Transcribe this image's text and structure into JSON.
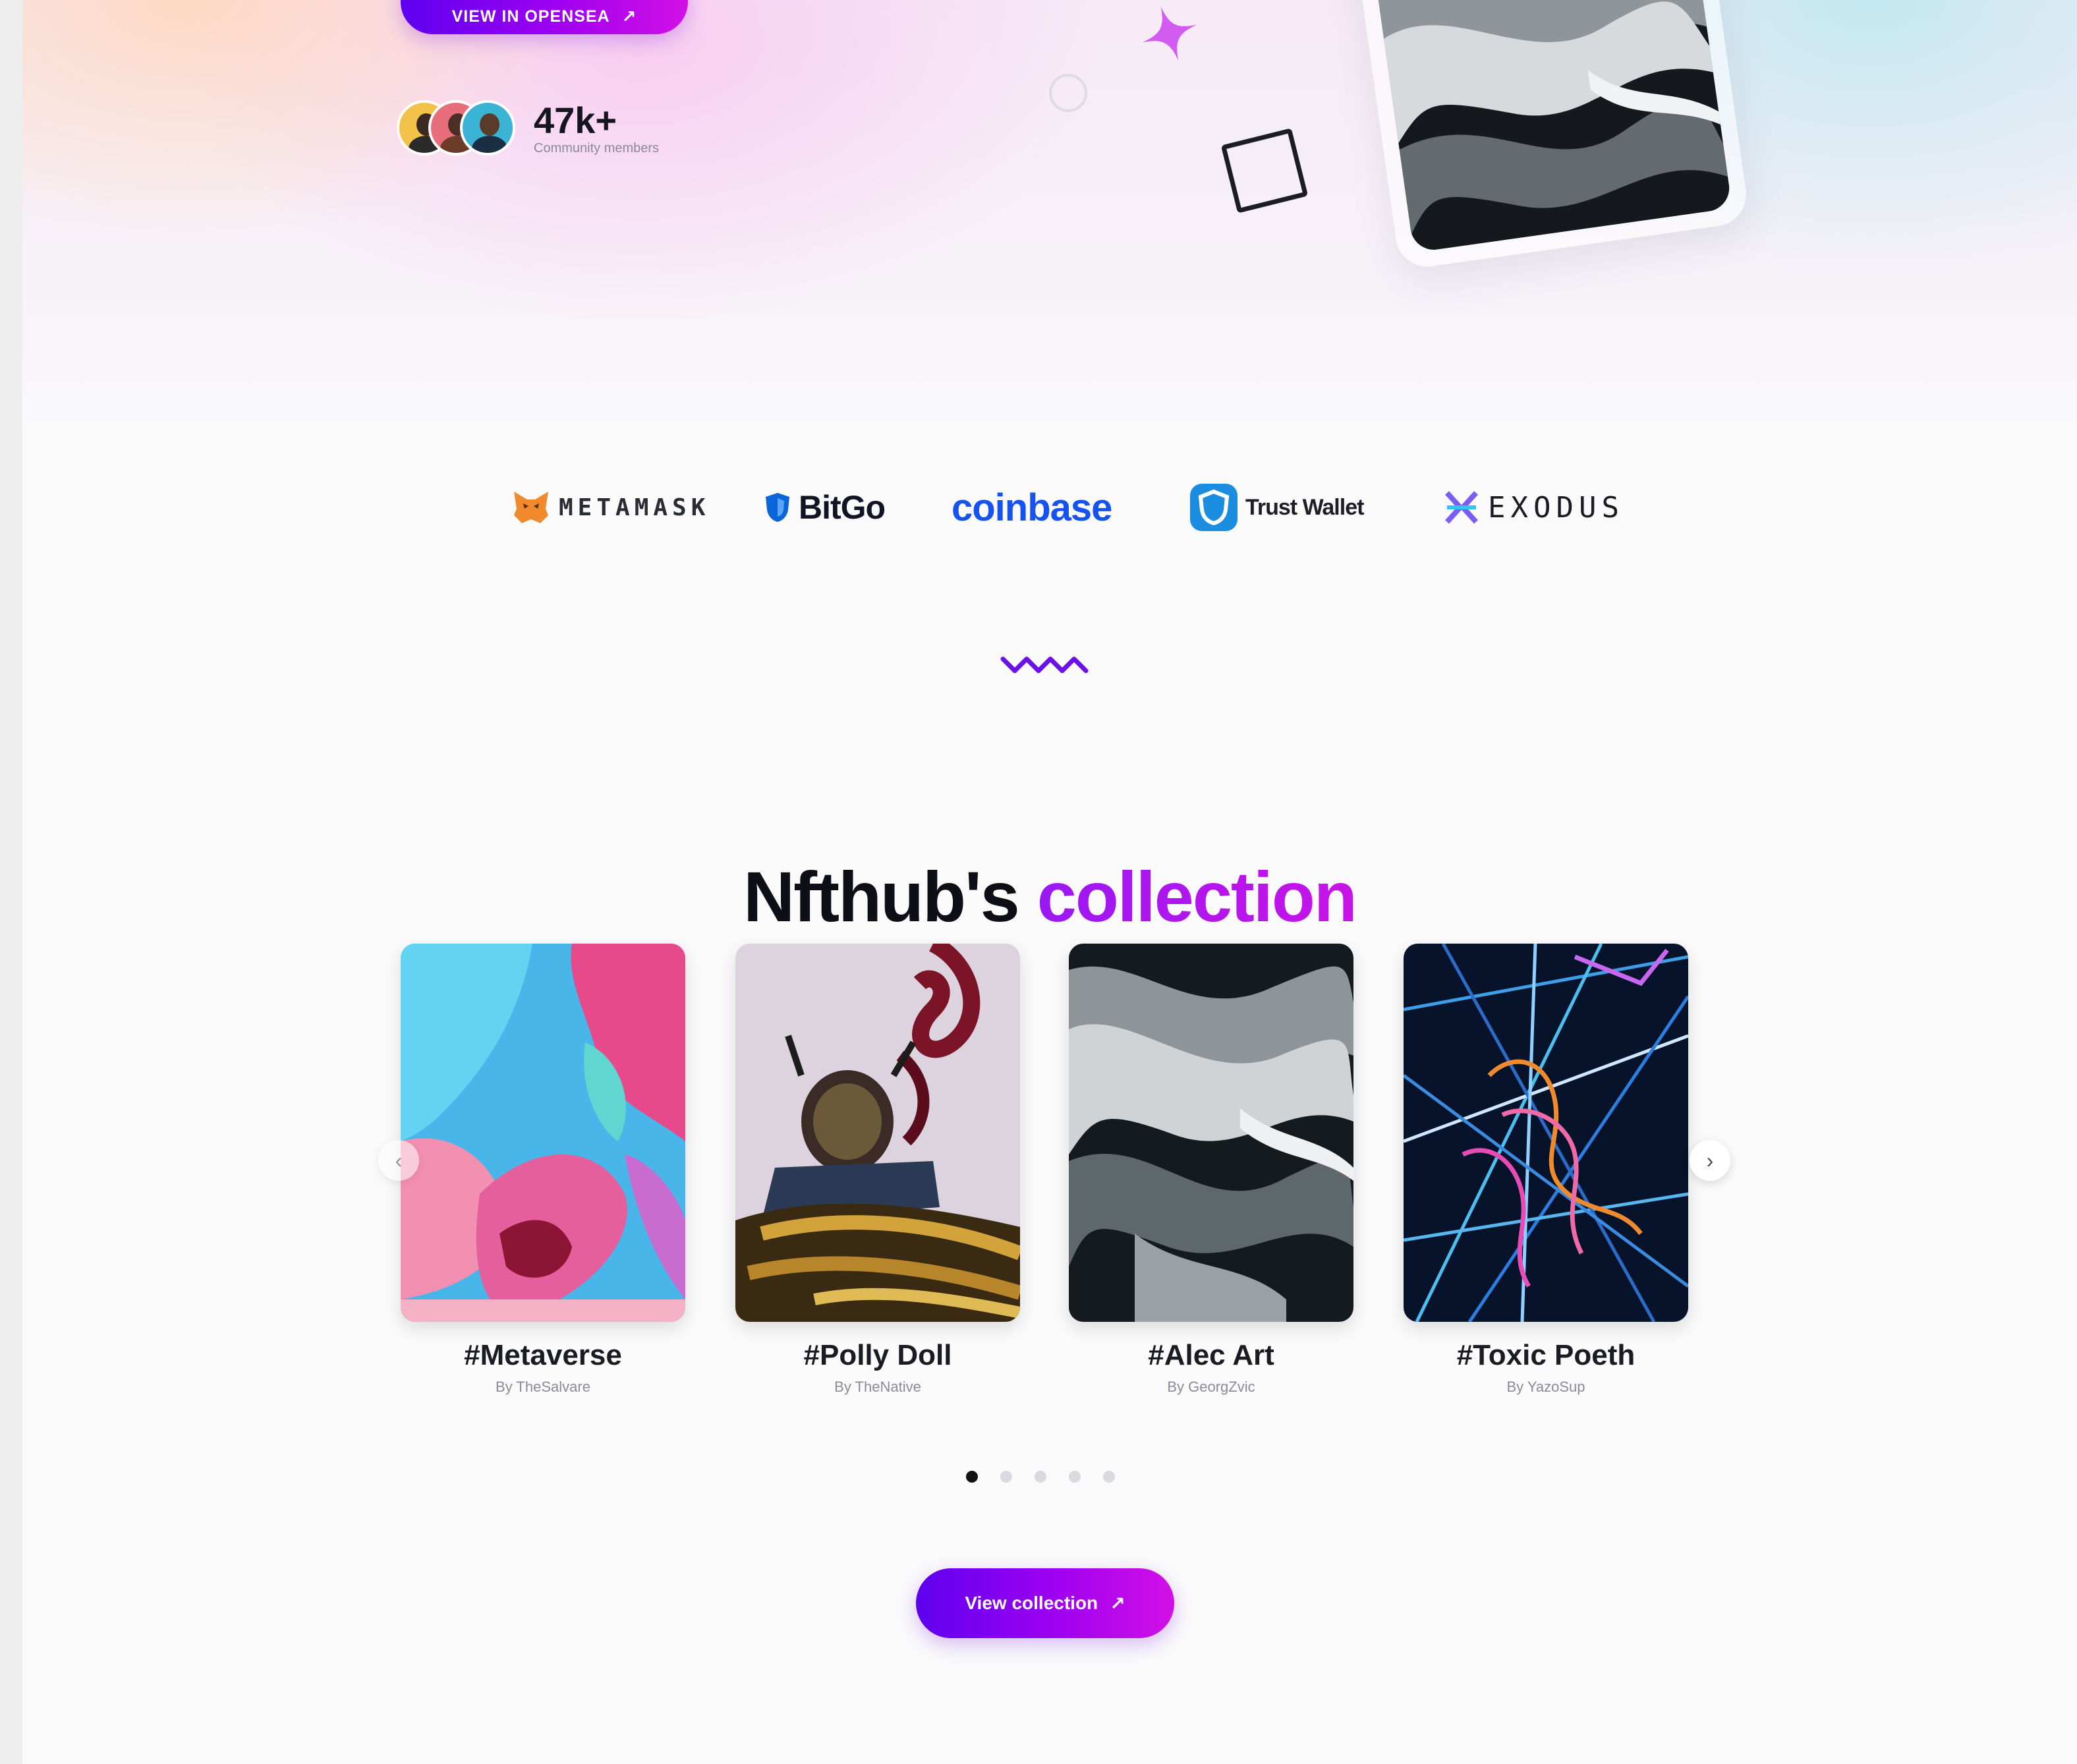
{
  "hero": {
    "top_button": {
      "label": "VIEW IN OPENSEA",
      "arrow": "↗"
    },
    "community": {
      "count": "47k+",
      "label": "Community members"
    },
    "colors": {
      "gradient_start": "#5e00f0",
      "gradient_end": "#d210e6",
      "star": "#d05cf0"
    }
  },
  "partners": [
    {
      "name": "METAMASK",
      "icon": "fox-icon"
    },
    {
      "name": "BitGo",
      "icon": "shield-icon"
    },
    {
      "name": "coinbase",
      "icon": ""
    },
    {
      "name": "Trust Wallet",
      "icon": "shield-check-icon"
    },
    {
      "name": "EXODUS",
      "icon": "exodus-x-icon"
    }
  ],
  "section": {
    "title_main": "Nfthub's",
    "title_accent": "collection",
    "accent_color": "#b414ee"
  },
  "collection": [
    {
      "title": "#Metaverse",
      "author": "By TheSalvare",
      "image": "abstract-paint"
    },
    {
      "title": "#Polly Doll",
      "author": "By TheNative",
      "image": "doll-figure"
    },
    {
      "title": "#Alec Art",
      "author": "By GeorgZvic",
      "image": "marble-swirl"
    },
    {
      "title": "#Toxic Poeth",
      "author": "By YazoSup",
      "image": "neon-lines"
    }
  ],
  "carousel": {
    "page_count": 5,
    "active_page": 1,
    "prev_icon": "‹",
    "next_icon": "›"
  },
  "footer_button": {
    "label": "View collection",
    "arrow": "↗"
  }
}
